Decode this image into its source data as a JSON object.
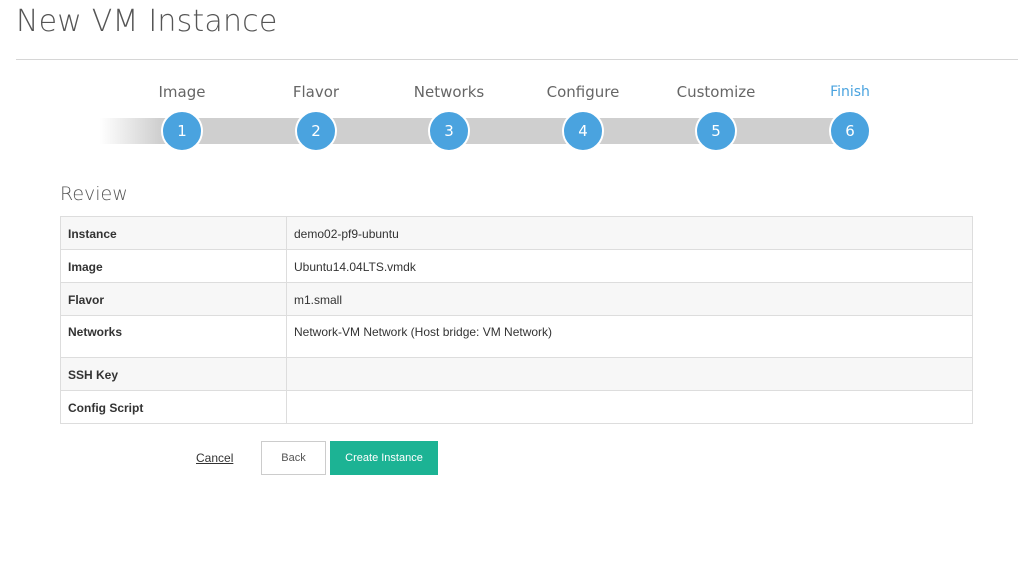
{
  "page": {
    "title": "New VM Instance"
  },
  "wizard": {
    "steps": [
      {
        "label": "Image",
        "number": "1"
      },
      {
        "label": "Flavor",
        "number": "2"
      },
      {
        "label": "Networks",
        "number": "3"
      },
      {
        "label": "Configure",
        "number": "4"
      },
      {
        "label": "Customize",
        "number": "5"
      },
      {
        "label": "Finish",
        "number": "6"
      }
    ],
    "active_step": "Finish"
  },
  "review": {
    "title": "Review",
    "rows": [
      {
        "key": "Instance",
        "value": "demo02-pf9-ubuntu"
      },
      {
        "key": "Image",
        "value": "Ubuntu14.04LTS.vmdk"
      },
      {
        "key": "Flavor",
        "value": "m1.small"
      },
      {
        "key": "Networks",
        "value": "Network-VM Network (Host bridge: VM Network)"
      },
      {
        "key": "SSH Key",
        "value": ""
      },
      {
        "key": "Config Script",
        "value": ""
      }
    ]
  },
  "actions": {
    "cancel_label": "Cancel",
    "back_label": "Back",
    "create_label": "Create Instance"
  },
  "colors": {
    "accent": "#4aa3df",
    "primary_button": "#1cb394"
  }
}
